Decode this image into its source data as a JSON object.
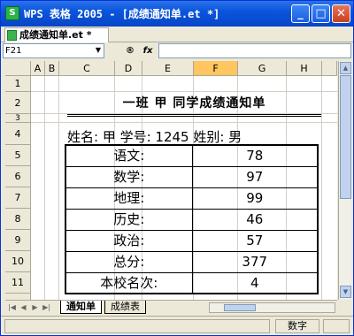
{
  "window": {
    "title": "WPS 表格 2005 - [成绩通知单.et *]"
  },
  "doc_tab": {
    "label": "成绩通知单.et *"
  },
  "formula_bar": {
    "name_box": "F21",
    "icon_1": "®",
    "icon_2": "fx"
  },
  "grid": {
    "columns": [
      "A",
      "B",
      "C",
      "D",
      "E",
      "F",
      "G",
      "H"
    ],
    "selected_column": "F",
    "rows": [
      "1",
      "2",
      "3",
      "4",
      "5",
      "6",
      "7",
      "8",
      "9",
      "10",
      "11"
    ]
  },
  "report": {
    "title": "一班  甲  同学成绩通知单",
    "info": "姓名: 甲  学号: 1245  姓别: 男",
    "rows": [
      {
        "label": "语文:",
        "value": "78"
      },
      {
        "label": "数学:",
        "value": "97"
      },
      {
        "label": "地理:",
        "value": "99"
      },
      {
        "label": "历史:",
        "value": "46"
      },
      {
        "label": "政治:",
        "value": "57"
      },
      {
        "label": "总分:",
        "value": "377"
      },
      {
        "label": "本校名次:",
        "value": "4"
      }
    ]
  },
  "sheet_tabs": [
    "通知单",
    "成绩表"
  ],
  "status_bar": {
    "mode": "数字"
  },
  "colors": {
    "title_bar": "#0a55dd",
    "selected_header": "#ffc55f",
    "chrome": "#ece9d8"
  }
}
